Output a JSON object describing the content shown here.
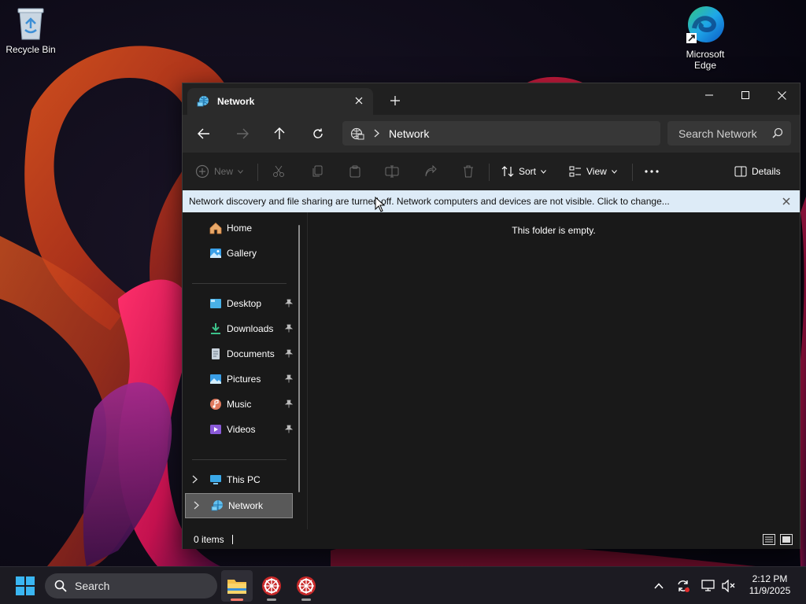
{
  "desktop": {
    "icons": [
      {
        "label": "Recycle Bin",
        "icon": "recycle-bin-icon"
      },
      {
        "label": "Microsoft Edge",
        "line1": "Microsoft",
        "line2": "Edge",
        "icon": "edge-icon"
      }
    ]
  },
  "window": {
    "tab_title": "Network",
    "tab_icon": "network-icon",
    "address": {
      "crumb": "Network"
    },
    "search": {
      "placeholder": "Search Network"
    },
    "toolbar": {
      "new_label": "New",
      "sort_label": "Sort",
      "view_label": "View",
      "details_label": "Details"
    },
    "infobar": {
      "message": "Network discovery and file sharing are turned off. Network computers and devices are not visible. Click to change..."
    },
    "sidebar": {
      "items": [
        {
          "label": "Home",
          "icon": "home-icon"
        },
        {
          "label": "Gallery",
          "icon": "gallery-icon"
        },
        {
          "label": "Desktop",
          "icon": "desktop-icon",
          "pinned": true
        },
        {
          "label": "Downloads",
          "icon": "downloads-icon",
          "pinned": true
        },
        {
          "label": "Documents",
          "icon": "documents-icon",
          "pinned": true
        },
        {
          "label": "Pictures",
          "icon": "pictures-icon",
          "pinned": true
        },
        {
          "label": "Music",
          "icon": "music-icon",
          "pinned": true
        },
        {
          "label": "Videos",
          "icon": "videos-icon",
          "pinned": true
        },
        {
          "label": "This PC",
          "icon": "this-pc-icon"
        },
        {
          "label": "Network",
          "icon": "network-icon",
          "selected": true
        }
      ]
    },
    "content": {
      "empty_message": "This folder is empty."
    },
    "status": {
      "items_count": "0 items"
    }
  },
  "taskbar": {
    "search_label": "Search",
    "clock": {
      "time": "2:12 PM",
      "date": "11/9/2025"
    }
  },
  "colors": {
    "accent": "#4cc2ff",
    "window_bg": "#191919",
    "infobar_bg": "#ddebf7",
    "selected_bg": "#595959"
  }
}
